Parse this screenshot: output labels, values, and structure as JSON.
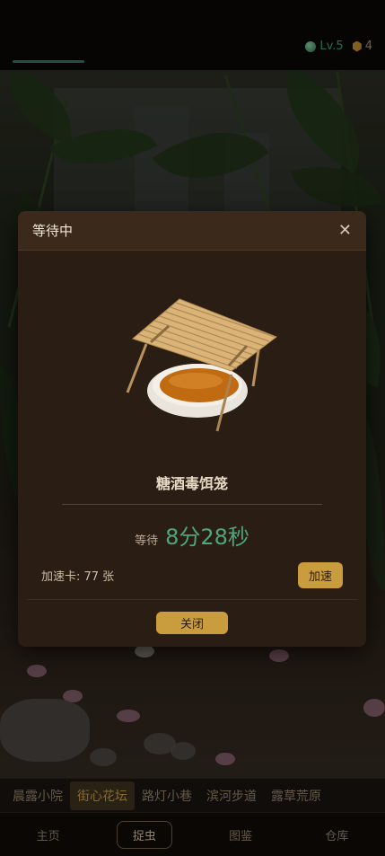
{
  "header": {
    "level": "Lv.5",
    "coins": "4"
  },
  "modal": {
    "title": "等待中",
    "item_name": "糖酒毒饵笼",
    "wait_label": "等待",
    "wait_time": "8分28秒",
    "speed_card_label": "加速卡: 77 张",
    "speed_button": "加速",
    "close_button": "关闭"
  },
  "locations": [
    {
      "label": "晨露小院",
      "active": false
    },
    {
      "label": "街心花坛",
      "active": true
    },
    {
      "label": "路灯小巷",
      "active": false
    },
    {
      "label": "滨河步道",
      "active": false
    },
    {
      "label": "露草荒原",
      "active": false
    }
  ],
  "nav": [
    {
      "label": "主页",
      "active": false
    },
    {
      "label": "捉虫",
      "active": true
    },
    {
      "label": "图鉴",
      "active": false
    },
    {
      "label": "仓库",
      "active": false
    }
  ],
  "colors": {
    "accent_gold": "#c99d3e",
    "timer_green": "#4ea67f",
    "level_green": "#3d8f77"
  }
}
